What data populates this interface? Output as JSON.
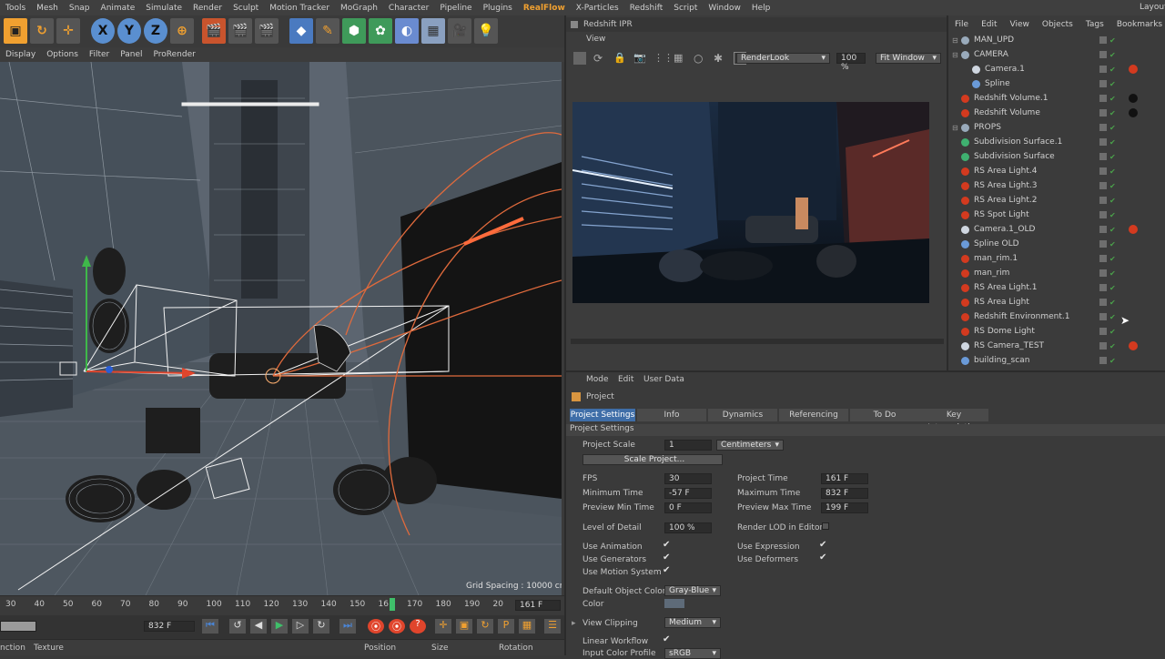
{
  "menubar": {
    "items": [
      "Tools",
      "Mesh",
      "Snap",
      "Animate",
      "Simulate",
      "Render",
      "Sculpt",
      "Motion Tracker",
      "MoGraph",
      "Character",
      "Pipeline",
      "Plugins",
      "RealFlow",
      "X-Particles",
      "Redshift",
      "Script",
      "Window",
      "Help"
    ],
    "layout_label": "Layout"
  },
  "viewport": {
    "menu": [
      "Display",
      "Options",
      "Filter",
      "Panel",
      "ProRender"
    ],
    "grid_spacing": "Grid Spacing : 10000 cm"
  },
  "timeline": {
    "ticks": [
      "30",
      "40",
      "50",
      "60",
      "70",
      "80",
      "90",
      "100",
      "110",
      "120",
      "130",
      "140",
      "150",
      "161",
      "170",
      "180",
      "190",
      "20"
    ],
    "current_frame": "161 F",
    "end_frame": "832 F"
  },
  "attrbar": {
    "items": [
      "nction",
      "Texture",
      "Position",
      "Size",
      "Rotation"
    ]
  },
  "ipr": {
    "title": "Redshift IPR",
    "view_menu": "View",
    "renderlook": "RenderLook",
    "zoom": "100 %",
    "fit": "Fit Window"
  },
  "objman": {
    "menu": [
      "File",
      "Edit",
      "View",
      "Objects",
      "Tags",
      "Bookmarks"
    ],
    "objects": [
      {
        "name": "MAN_UPD",
        "icon": "null-icon"
      },
      {
        "name": "CAMERA",
        "icon": "null-icon"
      },
      {
        "name": "Camera.1",
        "icon": "camera-icon"
      },
      {
        "name": "Spline",
        "icon": "spline-icon"
      },
      {
        "name": "Redshift Volume.1",
        "icon": "redshift-icon"
      },
      {
        "name": "Redshift Volume",
        "icon": "redshift-icon"
      },
      {
        "name": "PROPS",
        "icon": "null-icon"
      },
      {
        "name": "Subdivision Surface.1",
        "icon": "subdiv-icon"
      },
      {
        "name": "Subdivision Surface",
        "icon": "subdiv-icon"
      },
      {
        "name": "RS Area Light.4",
        "icon": "redshift-icon"
      },
      {
        "name": "RS Area Light.3",
        "icon": "redshift-icon"
      },
      {
        "name": "RS Area Light.2",
        "icon": "redshift-icon"
      },
      {
        "name": "RS Spot Light",
        "icon": "redshift-icon"
      },
      {
        "name": "Camera.1_OLD",
        "icon": "camera-icon"
      },
      {
        "name": "Spline OLD",
        "icon": "spline-icon"
      },
      {
        "name": "man_rim.1",
        "icon": "redshift-icon"
      },
      {
        "name": "man_rim",
        "icon": "redshift-icon"
      },
      {
        "name": "RS Area Light.1",
        "icon": "redshift-icon"
      },
      {
        "name": "RS Area Light",
        "icon": "redshift-icon"
      },
      {
        "name": "Redshift Environment.1",
        "icon": "redshift-icon"
      },
      {
        "name": "RS Dome Light",
        "icon": "redshift-icon"
      },
      {
        "name": "RS Camera_TEST",
        "icon": "camera-icon"
      },
      {
        "name": "building_scan",
        "icon": "mesh-icon"
      }
    ]
  },
  "attr": {
    "menu": [
      "Mode",
      "Edit",
      "User Data"
    ],
    "object_label": "Project",
    "tabs": [
      "Project Settings",
      "Info",
      "Dynamics",
      "Referencing",
      "To Do",
      "Key Interpolation"
    ],
    "section": "Project Settings",
    "project_scale_label": "Project Scale",
    "project_scale": "1",
    "project_scale_unit": "Centimeters",
    "scale_project_button": "Scale Project...",
    "fps_label": "FPS",
    "fps": "30",
    "project_time_label": "Project Time",
    "project_time": "161 F",
    "min_time_label": "Minimum Time",
    "min_time": "-57 F",
    "max_time_label": "Maximum Time",
    "max_time": "832 F",
    "preview_min_label": "Preview Min Time",
    "preview_min": "0 F",
    "preview_max_label": "Preview Max Time",
    "preview_max": "199 F",
    "lod_label": "Level of Detail",
    "lod": "100 %",
    "render_lod_label": "Render LOD in Editor",
    "use_animation": "Use Animation",
    "use_expression": "Use Expression",
    "use_generators": "Use Generators",
    "use_deformers": "Use Deformers",
    "use_motion_system": "Use Motion System",
    "default_color_label": "Default Object Color",
    "default_color": "Gray-Blue",
    "color_label": "Color",
    "view_clipping_label": "View Clipping",
    "view_clipping": "Medium",
    "linear_workflow_label": "Linear Workflow",
    "input_color_label": "Input Color Profile",
    "input_color": "sRGB"
  },
  "colors": {
    "accent": "#f0a030",
    "tab_active": "#3f6ea8",
    "redshift": "#d33a1f"
  }
}
